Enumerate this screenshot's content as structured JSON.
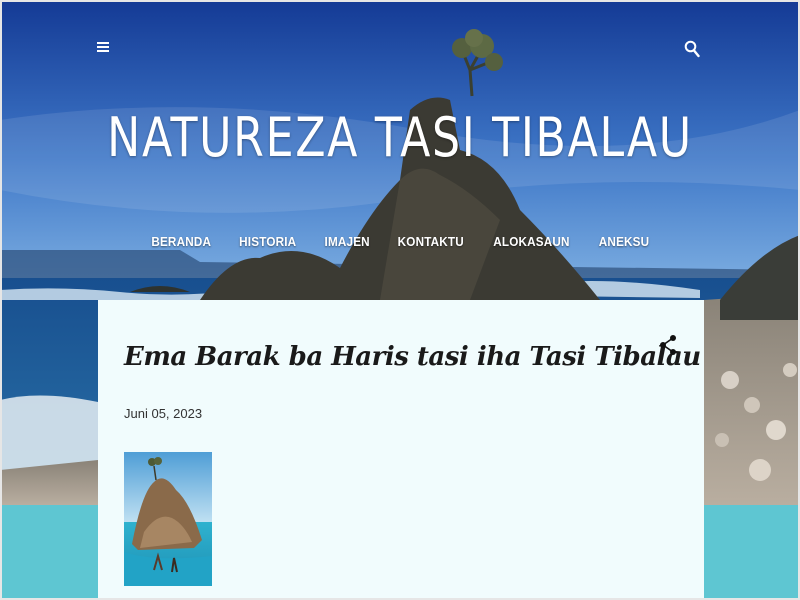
{
  "header": {
    "site_title": "NATUREZA TASI TIBALAU",
    "menu_icon": "hamburger-menu-icon",
    "search_icon": "search-icon"
  },
  "nav": {
    "items": [
      {
        "label": "BERANDA"
      },
      {
        "label": "HISTORIA"
      },
      {
        "label": "IMAJEN"
      },
      {
        "label": "KONTAKTU"
      },
      {
        "label": "ALOKASAUN"
      },
      {
        "label": "ANEKSU"
      }
    ]
  },
  "post": {
    "title": "Ema Barak ba Haris tasi iha Tasi Tibalau",
    "date": "Juni 05, 2023",
    "share_icon": "share-icon"
  },
  "colors": {
    "sky_top": "#173f9a",
    "sky_bottom": "#5b95d8",
    "sea": "#1f5f9c",
    "footer_band": "#5ec6d2",
    "card_background": "#f1fcfd"
  }
}
